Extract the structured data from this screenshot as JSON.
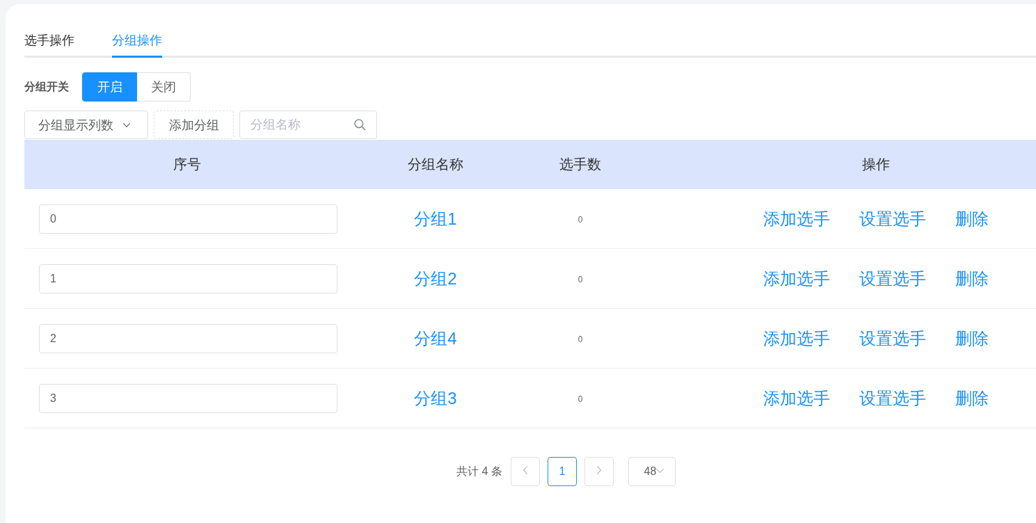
{
  "tabs": [
    {
      "label": "选手操作",
      "selected": false
    },
    {
      "label": "分组操作",
      "selected": true
    }
  ],
  "group_switch": {
    "label": "分组开关",
    "options": [
      {
        "label": "开启",
        "selected": true
      },
      {
        "label": "关闭",
        "selected": false
      }
    ]
  },
  "toolbar": {
    "column_select": {
      "label": "分组显示列数"
    },
    "add_button": {
      "label": "添加分组"
    },
    "search": {
      "placeholder": "分组名称"
    }
  },
  "table": {
    "columns": [
      "序号",
      "分组名称",
      "选手数",
      "操作"
    ],
    "rows": [
      {
        "order": "0",
        "name": "分组1",
        "players": "0",
        "actions": [
          "添加选手",
          "设置选手",
          "删除"
        ]
      },
      {
        "order": "1",
        "name": "分组2",
        "players": "0",
        "actions": [
          "添加选手",
          "设置选手",
          "删除"
        ]
      },
      {
        "order": "2",
        "name": "分组4",
        "players": "0",
        "actions": [
          "添加选手",
          "设置选手",
          "删除"
        ]
      },
      {
        "order": "3",
        "name": "分组3",
        "players": "0",
        "actions": [
          "添加选手",
          "设置选手",
          "删除"
        ]
      }
    ]
  },
  "pagination": {
    "total": "共计 4 条",
    "previous": {
      "disabled": true
    },
    "pages": [
      {
        "label": "1",
        "selected": true
      }
    ],
    "next": {
      "disabled": true
    },
    "page_size": "48"
  }
}
